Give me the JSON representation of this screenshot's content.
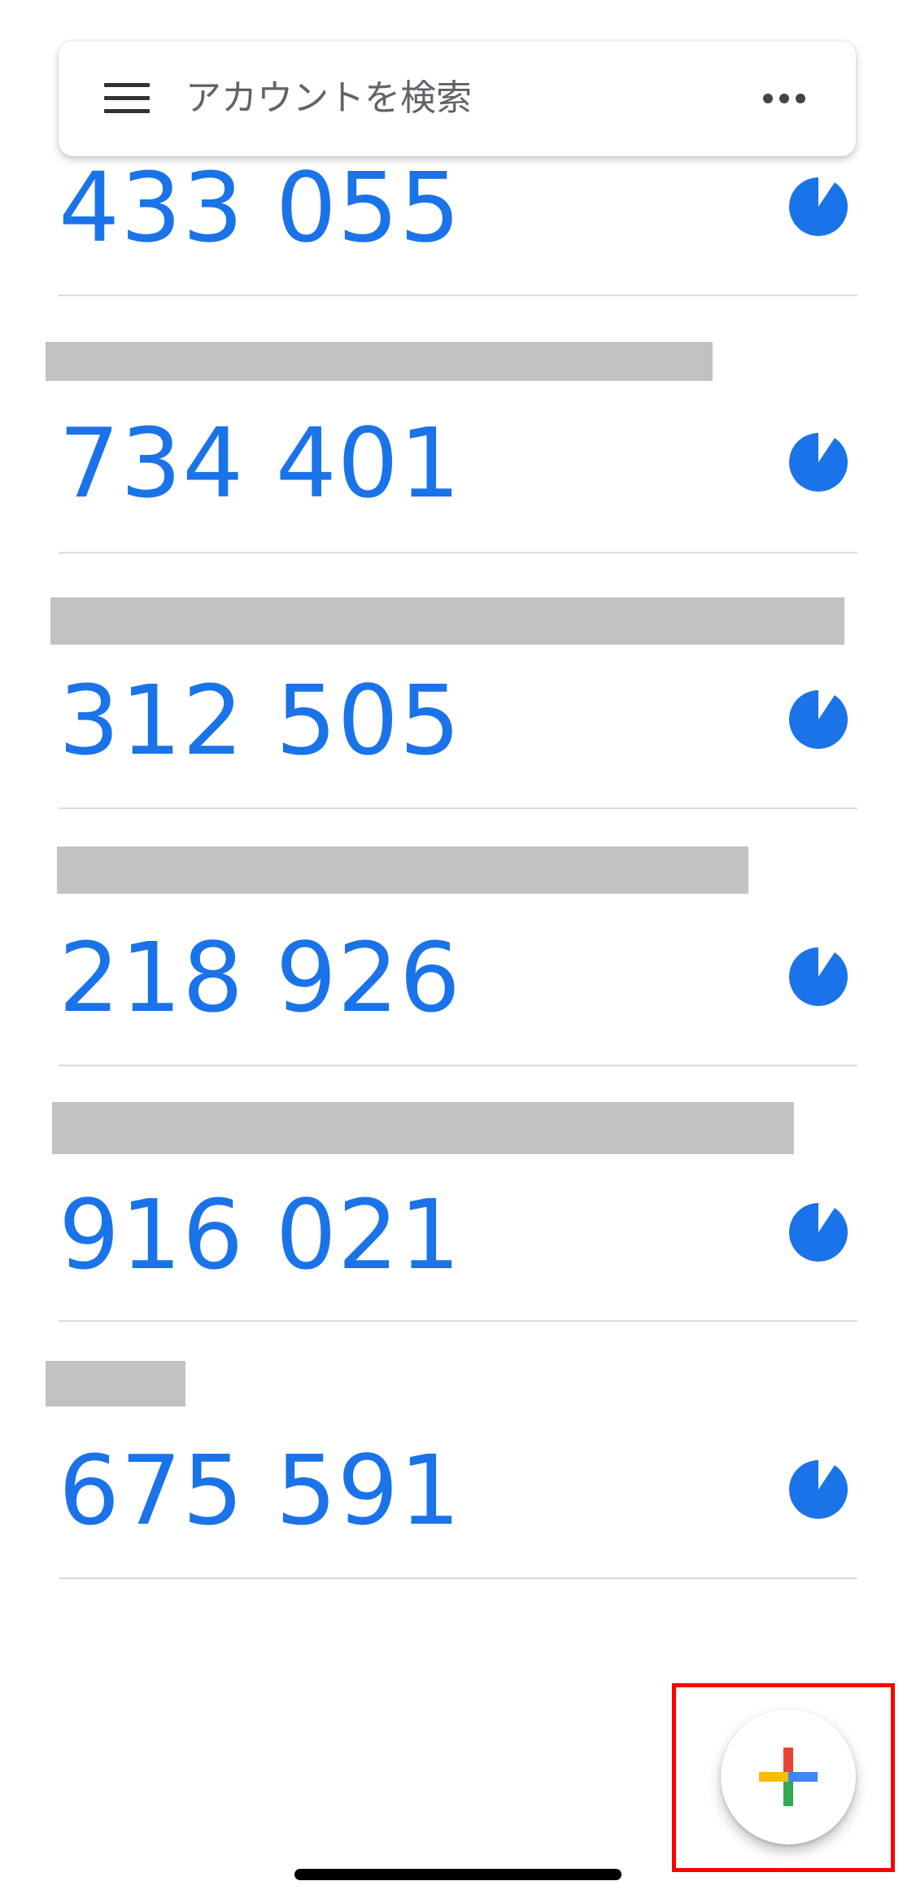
{
  "search": {
    "placeholder": "アカウントを検索",
    "menu_icon": "hamburger-menu-icon",
    "more_icon": "more-horizontal-icon"
  },
  "accounts": [
    {
      "code": "433 055",
      "name_redacted": true,
      "timer_icon": "countdown-timer-icon"
    },
    {
      "code": "734 401",
      "name_redacted": true,
      "timer_icon": "countdown-timer-icon"
    },
    {
      "code": "312 505",
      "name_redacted": true,
      "timer_icon": "countdown-timer-icon"
    },
    {
      "code": "218 926",
      "name_redacted": true,
      "timer_icon": "countdown-timer-icon"
    },
    {
      "code": "916 021",
      "name_redacted": true,
      "timer_icon": "countdown-timer-icon"
    },
    {
      "code": "675 591",
      "name_redacted": true,
      "timer_icon": "countdown-timer-icon"
    }
  ],
  "fab": {
    "icon": "add-plus-icon",
    "highlighted": true
  },
  "colors": {
    "code_blue": "#1a73e8",
    "redaction_gray": "#c2c2c2",
    "divider": "#dadce0",
    "highlight_red": "#ff0000",
    "plus_red": "#ea4335",
    "plus_yellow": "#fbbc04",
    "plus_green": "#34a853",
    "plus_blue": "#4285f4"
  }
}
